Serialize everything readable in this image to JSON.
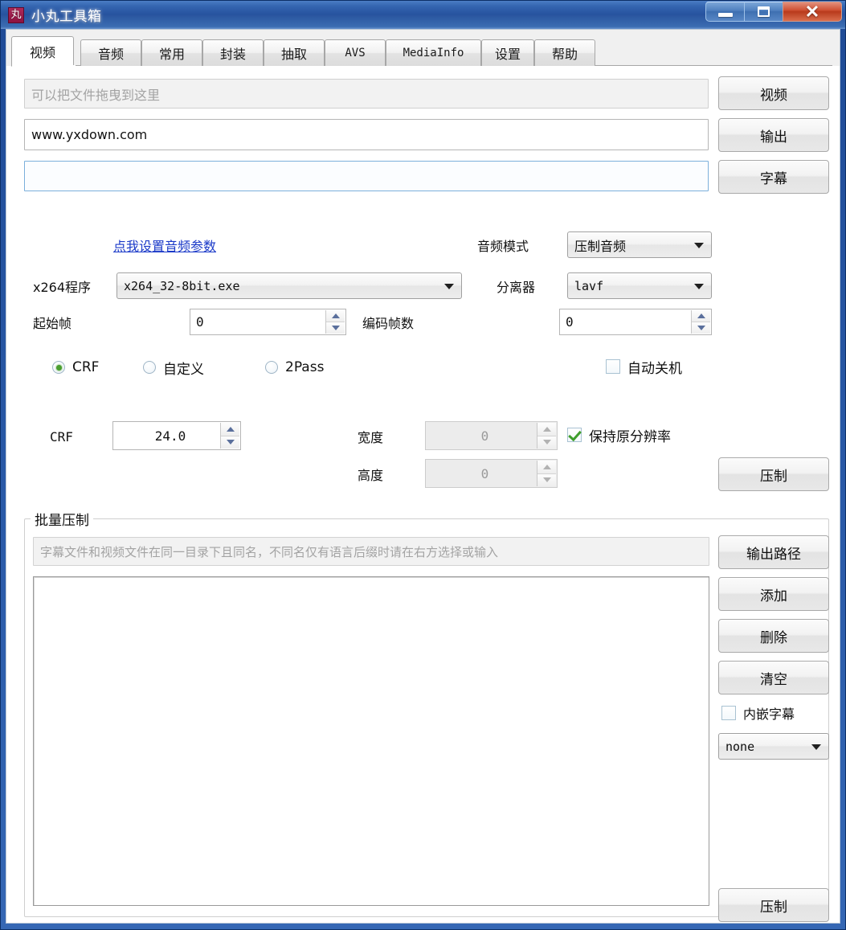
{
  "window": {
    "title": "小丸工具箱",
    "icon_glyph": "丸",
    "icon_name": "app-icon",
    "caption": {
      "minimize": "minimize-icon",
      "maximize": "maximize-icon",
      "close": "close-icon",
      "close_glyph": "✕"
    },
    "colors": {
      "titlebar_blue": "#27539f",
      "close_red": "#b83a1c",
      "link_blue": "#1a39c8",
      "check_green": "#3f9e2d",
      "radio_green": "#4a9e2f"
    }
  },
  "tabs": [
    {
      "label": "视频",
      "active": true,
      "mono": false
    },
    {
      "label": "音频",
      "active": false,
      "mono": false
    },
    {
      "label": "常用",
      "active": false,
      "mono": false
    },
    {
      "label": "封装",
      "active": false,
      "mono": false
    },
    {
      "label": "抽取",
      "active": false,
      "mono": false
    },
    {
      "label": "AVS",
      "active": false,
      "mono": true
    },
    {
      "label": "MediaInfo",
      "active": false,
      "mono": true
    },
    {
      "label": "设置",
      "active": false,
      "mono": false
    },
    {
      "label": "帮助",
      "active": false,
      "mono": false
    }
  ],
  "video_tab": {
    "file_rows": [
      {
        "name": "video-input",
        "value": "",
        "placeholder": "可以把文件拖曳到这里",
        "button": "视频"
      },
      {
        "name": "output-input",
        "value": "www.yxdown.com",
        "placeholder": "",
        "button": "输出"
      },
      {
        "name": "subtitle-input",
        "value": "",
        "placeholder": "",
        "button": "字幕"
      }
    ],
    "audio_params_link": "点我设置音频参数",
    "audio_mode_label": "音频模式",
    "audio_mode_value": "压制音频",
    "x264_label": "x264程序",
    "x264_value": "x264_32-8bit.exe",
    "demuxer_label": "分离器",
    "demuxer_value": "lavf",
    "start_frame_label": "起始帧",
    "start_frame_value": "0",
    "frame_count_label": "编码帧数",
    "frame_count_value": "0",
    "modes": [
      {
        "label": "CRF",
        "selected": true
      },
      {
        "label": "自定义",
        "selected": false
      },
      {
        "label": "2Pass",
        "selected": false
      }
    ],
    "auto_shutdown_label": "自动关机",
    "auto_shutdown_checked": false,
    "crf_label": "CRF",
    "crf_value": "24.0",
    "width_label": "宽度",
    "width_value": "0",
    "height_label": "高度",
    "height_value": "0",
    "keep_resolution_label": "保持原分辨率",
    "keep_resolution_checked": true,
    "encode_button": "压制"
  },
  "batch": {
    "group_title": "批量压制",
    "path_placeholder": "字幕文件和视频文件在同一目录下且同名，不同名仅有语言后缀时请在右方选择或输入",
    "path_value": "",
    "buttons": [
      "输出路径",
      "添加",
      "删除",
      "清空"
    ],
    "embed_subtitle_label": "内嵌字幕",
    "embed_subtitle_checked": false,
    "subtitle_lang_value": "none",
    "list_items": [],
    "encode_button": "压制"
  }
}
